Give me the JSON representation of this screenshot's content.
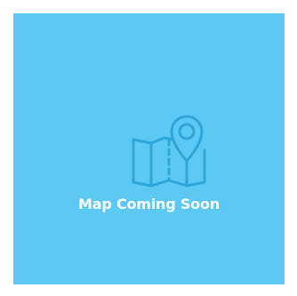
{
  "placeholder": {
    "message": "Map Coming Soon",
    "icon": "map-pin-icon",
    "background_color": "#5bc9f3",
    "icon_color": "#2fa6da",
    "text_color": "#ffffff"
  }
}
